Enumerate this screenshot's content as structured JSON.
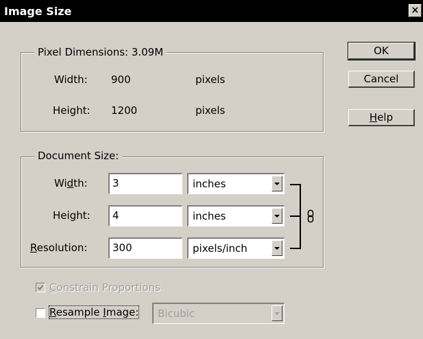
{
  "window": {
    "title": "Image Size",
    "close_glyph": "×"
  },
  "pixel_dimensions": {
    "legend": "Pixel Dimensions:  3.09M",
    "width_label": "Width:",
    "width_value": "900",
    "width_unit": "pixels",
    "height_label": "Height:",
    "height_value": "1200",
    "height_unit": "pixels"
  },
  "document_size": {
    "legend": "Document Size:",
    "width_label_pre": "Wi",
    "width_label_acc": "d",
    "width_label_post": "th:",
    "width_value": "3",
    "width_unit": "inches",
    "height_label_pre": "Hei",
    "height_label_acc": "g",
    "height_label_post": "ht:",
    "height_value": "4",
    "height_unit": "inches",
    "resolution_label_acc": "R",
    "resolution_label_post": "esolution:",
    "resolution_value": "300",
    "resolution_unit": "pixels/inch"
  },
  "buttons": {
    "ok": "OK",
    "cancel": "Cancel",
    "help_acc": "H",
    "help_post": "elp"
  },
  "constrain": {
    "label_acc": "C",
    "label_post": "onstrain Proportions",
    "checked": true,
    "disabled": true
  },
  "resample": {
    "label_acc": "R",
    "label_mid": "esample ",
    "label_acc2": "I",
    "label_post": "mage:",
    "checked": false,
    "method": "Bicubic",
    "icon": "link-chain-icon"
  }
}
